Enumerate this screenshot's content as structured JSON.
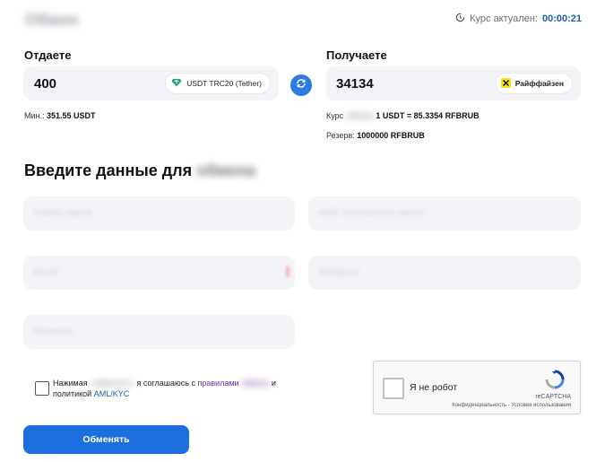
{
  "page": {
    "title": "Обмен"
  },
  "timer": {
    "label": "Курс актуален:",
    "value": "00:00:21"
  },
  "give": {
    "label": "Отдаете",
    "amount": "400",
    "currency": "USDT TRC20 (Tether)",
    "currency_icon": "tether-diamond-icon",
    "min_label": "Мин.:",
    "min_value": "351.55 USDT"
  },
  "receive": {
    "label": "Получаете",
    "amount": "34134",
    "currency": "Райффайзен",
    "currency_icon": "raiffeisen-icon",
    "rate_label": "Курс",
    "rate_blur": "обмена",
    "rate_value": "1 USDT = 85.3354 RFBRUB",
    "reserve_label": "Резерв:",
    "reserve_value": "1000000 RFBRUB"
  },
  "form": {
    "heading": "Введите данные для",
    "heading_blur": "обмена",
    "fields": [
      {
        "placeholder": "Номер карты"
      },
      {
        "placeholder": "ФИО получателя карты"
      },
      {
        "placeholder": "Email"
      },
      {
        "placeholder": "Telegram"
      },
      {
        "placeholder": "Кошелек"
      }
    ]
  },
  "agreement": {
    "text_start": "Нажимая",
    "text_blur": "«обменять»",
    "text_mid": "я соглашаюсь с",
    "rules_link": "правилами",
    "rules_blur": "обмена",
    "text_and": "и",
    "text_policy": "политикой",
    "kyc_link": "AML/KYC"
  },
  "captcha": {
    "label": "Я не робот",
    "brand": "reCAPTCHA",
    "terms": "Конфиденциальность - Условия использования"
  },
  "submit": {
    "label": "Обменять"
  },
  "colors": {
    "accent": "#1d6fe0",
    "timer": "#1b5fa6",
    "link": "#6b2fa0",
    "field_bg": "#f2f4f7"
  }
}
